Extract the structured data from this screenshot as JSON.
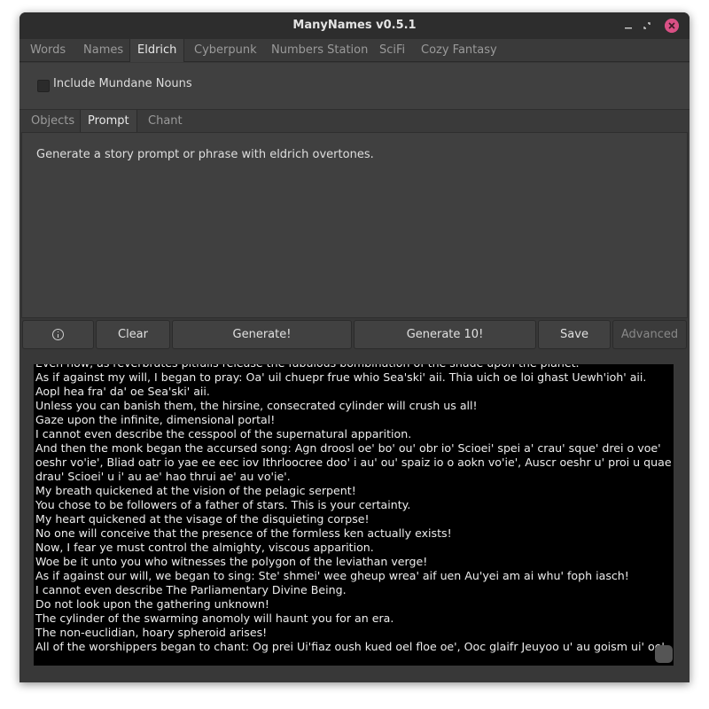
{
  "window": {
    "title": "ManyNames v0.5.1"
  },
  "tabs": [
    "Words",
    "Names",
    "Eldrich",
    "Cyberpunk",
    "Numbers Station",
    "SciFi",
    "Cozy Fantasy"
  ],
  "active_tab": "Eldrich",
  "options": {
    "mundane_label": "Include Mundane Nouns",
    "mundane_checked": false
  },
  "subtabs": [
    "Objects",
    "Prompt",
    "Chant"
  ],
  "active_subtab": "Prompt",
  "description": "Generate a story prompt or phrase with eldrich overtones.",
  "buttons": {
    "info_icon": "info-icon",
    "clear": "Clear",
    "generate": "Generate!",
    "generate10": "Generate 10!",
    "save": "Save",
    "advanced": "Advanced"
  },
  "output_lines": [
    "Even now, as reverbrates pitfalls release the fabulous bombination of the shade upon the planet.",
    "As if against my will, I began to pray: Oa' uil chuepr frue whio Sea'ski' aii. Thia uich oe loi ghast Uewh'ioh' aii. Aopl hea fra' da' oe Sea'ski' aii.",
    "Unless you can banish them, the hirsine, consecrated cylinder will crush us all!",
    "Gaze upon the infinite, dimensional portal!",
    "I cannot even describe the cesspool of the supernatural apparition.",
    "And then the monk began the accursed song: Agn droosl oe' bo' ou' obr io' Scioei' spei a' crau' sque' drei o voe' oeshr vo'ie', Bliad oatr io yae ee eec iov Ithrloocree doo' i au' ou' spaiz io o aokn vo'ie', Auscr oeshr u' proi u quae drau' Scioei' u i' au ae' hao thrui ae' au vo'ie'.",
    "My breath quickened at the vision of the pelagic serpent!",
    "You chose to be followers of a father of stars. This is your certainty.",
    "My heart quickened at the visage of the disquieting corpse!",
    "No one will conceive that the presence of the formless ken actually exists!",
    "Now, I fear ye must control the almighty, viscous apparition.",
    "Woe be it unto you who witnesses the polygon of the leviathan verge!",
    "As if against our will, we began to sing: Ste' shmei' wee gheup wrea' aif uen Au'yei am ai whu' foph iasch!",
    "I cannot even describe The Parliamentary Divine Being.",
    "Do not look upon the gathering unknown!",
    "The cylinder of the swarming anomoly will haunt you for an era.",
    "The non-euclidian, hoary spheroid arises!",
    "All of the worshippers began to chant: Og prei Ui'fiaz oush kued oel floe oe', Ooc glaifr Jeuyoo u' au goism ui' oe'."
  ]
}
